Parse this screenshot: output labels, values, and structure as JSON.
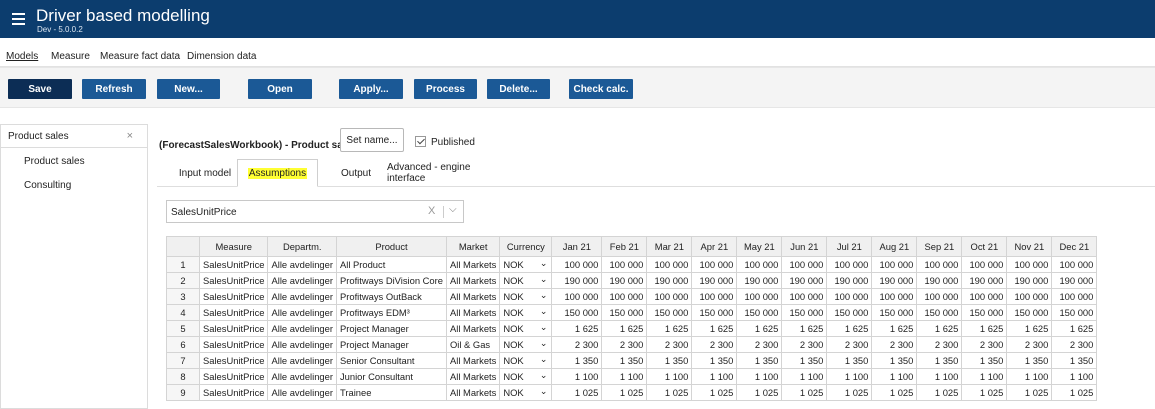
{
  "app": {
    "title": "Driver based modelling",
    "version": "Dev - 5.0.0.2"
  },
  "menu": {
    "items": [
      "Models",
      "Measure",
      "Measure fact data",
      "Dimension data"
    ]
  },
  "toolbar": {
    "buttons": [
      "Save",
      "Refresh",
      "New...",
      "Open",
      "Apply...",
      "Process",
      "Delete...",
      "Check calc."
    ]
  },
  "sidebar": {
    "tab_label": "Product sales",
    "close_glyph": "×",
    "items": [
      "Product sales",
      "Consulting"
    ]
  },
  "model": {
    "title": "(ForecastSalesWorkbook) - Product sales",
    "set_name_label": "Set name...",
    "published_label": "Published",
    "published": true
  },
  "tabs": [
    "Input model",
    "Assumptions",
    "Output",
    "Advanced - engine interface"
  ],
  "active_tab": "Assumptions",
  "filter": {
    "value": "SalesUnitPrice",
    "clear_glyph": "X",
    "chevron_glyph": "⌵"
  },
  "grid": {
    "columns": [
      "",
      "Measure",
      "Departm.",
      "Product",
      "Market",
      "Currency",
      "Jan 21",
      "Feb 21",
      "Mar 21",
      "Apr 21",
      "May 21",
      "Jun 21",
      "Jul 21",
      "Aug 21",
      "Sep 21",
      "Oct 21",
      "Nov 21",
      "Dec 21"
    ],
    "rows": [
      {
        "idx": "1",
        "measure": "SalesUnitPrice",
        "dept": "Alle avdelinger",
        "product": "All Product",
        "market": "All Markets",
        "currency": "NOK",
        "values": [
          "100 000",
          "100 000",
          "100 000",
          "100 000",
          "100 000",
          "100 000",
          "100 000",
          "100 000",
          "100 000",
          "100 000",
          "100 000",
          "100 000"
        ]
      },
      {
        "idx": "2",
        "measure": "SalesUnitPrice",
        "dept": "Alle avdelinger",
        "product": "Profitways DiVision Core",
        "market": "All Markets",
        "currency": "NOK",
        "values": [
          "190 000",
          "190 000",
          "190 000",
          "190 000",
          "190 000",
          "190 000",
          "190 000",
          "190 000",
          "190 000",
          "190 000",
          "190 000",
          "190 000"
        ]
      },
      {
        "idx": "3",
        "measure": "SalesUnitPrice",
        "dept": "Alle avdelinger",
        "product": "Profitways OutBack",
        "market": "All Markets",
        "currency": "NOK",
        "values": [
          "100 000",
          "100 000",
          "100 000",
          "100 000",
          "100 000",
          "100 000",
          "100 000",
          "100 000",
          "100 000",
          "100 000",
          "100 000",
          "100 000"
        ]
      },
      {
        "idx": "4",
        "measure": "SalesUnitPrice",
        "dept": "Alle avdelinger",
        "product": "Profitways EDM³",
        "market": "All Markets",
        "currency": "NOK",
        "values": [
          "150 000",
          "150 000",
          "150 000",
          "150 000",
          "150 000",
          "150 000",
          "150 000",
          "150 000",
          "150 000",
          "150 000",
          "150 000",
          "150 000"
        ]
      },
      {
        "idx": "5",
        "measure": "SalesUnitPrice",
        "dept": "Alle avdelinger",
        "product": "Project Manager",
        "market": "All Markets",
        "currency": "NOK",
        "values": [
          "1 625",
          "1 625",
          "1 625",
          "1 625",
          "1 625",
          "1 625",
          "1 625",
          "1 625",
          "1 625",
          "1 625",
          "1 625",
          "1 625"
        ]
      },
      {
        "idx": "6",
        "measure": "SalesUnitPrice",
        "dept": "Alle avdelinger",
        "product": "Project Manager",
        "market": "Oil & Gas",
        "currency": "NOK",
        "values": [
          "2 300",
          "2 300",
          "2 300",
          "2 300",
          "2 300",
          "2 300",
          "2 300",
          "2 300",
          "2 300",
          "2 300",
          "2 300",
          "2 300"
        ]
      },
      {
        "idx": "7",
        "measure": "SalesUnitPrice",
        "dept": "Alle avdelinger",
        "product": "Senior Consultant",
        "market": "All Markets",
        "currency": "NOK",
        "values": [
          "1 350",
          "1 350",
          "1 350",
          "1 350",
          "1 350",
          "1 350",
          "1 350",
          "1 350",
          "1 350",
          "1 350",
          "1 350",
          "1 350"
        ]
      },
      {
        "idx": "8",
        "measure": "SalesUnitPrice",
        "dept": "Alle avdelinger",
        "product": "Junior Consultant",
        "market": "All Markets",
        "currency": "NOK",
        "values": [
          "1 100",
          "1 100",
          "1 100",
          "1 100",
          "1 100",
          "1 100",
          "1 100",
          "1 100",
          "1 100",
          "1 100",
          "1 100",
          "1 100"
        ]
      },
      {
        "idx": "9",
        "measure": "SalesUnitPrice",
        "dept": "Alle avdelinger",
        "product": "Trainee",
        "market": "All Markets",
        "currency": "NOK",
        "values": [
          "1 025",
          "1 025",
          "1 025",
          "1 025",
          "1 025",
          "1 025",
          "1 025",
          "1 025",
          "1 025",
          "1 025",
          "1 025",
          "1 025"
        ]
      }
    ],
    "dropdown_glyph": "⌄"
  },
  "colors": {
    "appbar": "#0c3d6e",
    "button": "#1b5996",
    "button_dark": "#0c2d55",
    "highlight": "#ffff33"
  },
  "icons": {
    "menu": "hamburger-icon",
    "close": "close-icon",
    "chevron": "chevron-down-icon",
    "check": "checkmark-icon"
  }
}
